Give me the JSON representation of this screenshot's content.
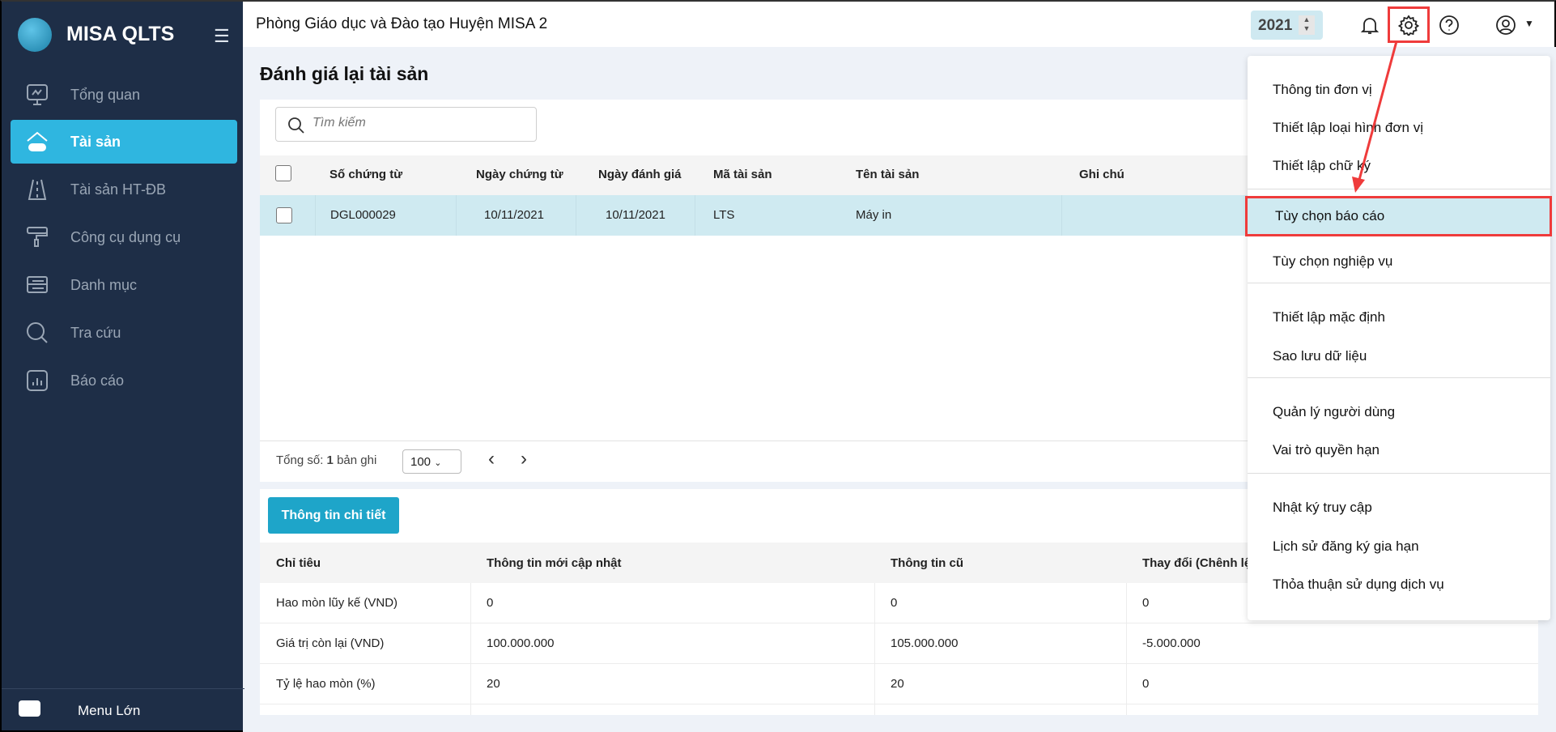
{
  "app": {
    "brand": "MISA QLTS",
    "org": "Phòng Giáo dục và Đào tạo Huyện MISA 2",
    "year": "2021"
  },
  "sidebar": {
    "items": [
      {
        "label": "Tổng quan",
        "icon": "monitor-icon"
      },
      {
        "label": "Tài sản",
        "icon": "house-car-icon",
        "active": true
      },
      {
        "label": "Tài sản HT-ĐB",
        "icon": "road-icon"
      },
      {
        "label": "Công cụ dụng cụ",
        "icon": "paint-roller-icon"
      },
      {
        "label": "Danh mục",
        "icon": "list-icon"
      },
      {
        "label": "Tra cứu",
        "icon": "search-icon"
      },
      {
        "label": "Báo cáo",
        "icon": "chart-icon"
      }
    ],
    "menu_toggle": "Menu Lớn"
  },
  "page": {
    "title": "Đánh giá lại tài sản",
    "search_placeholder": "Tìm kiếm"
  },
  "table": {
    "columns": [
      "Số chứng từ",
      "Ngày chứng từ",
      "Ngày đánh giá",
      "Mã tài sản",
      "Tên tài sản",
      "Ghi chú"
    ],
    "rows": [
      [
        "DGL000029",
        "10/11/2021",
        "10/11/2021",
        "LTS",
        "Máy in",
        ""
      ]
    ]
  },
  "footer": {
    "total_label": "Tổng số:",
    "total": "1",
    "total_suffix": "bản ghi",
    "page_size": "100"
  },
  "detail": {
    "button": "Thông tin chi tiết",
    "columns": [
      "Chỉ tiêu",
      "Thông tin mới cập nhật",
      "Thông tin cũ",
      "Thay đổi (Chênh lệ"
    ],
    "rows": [
      [
        "Hao mòn lũy kế (VND)",
        "0",
        "0",
        "0"
      ],
      [
        "Giá trị còn lại (VND)",
        "100.000.000",
        "105.000.000",
        "-5.000.000"
      ],
      [
        "Tỷ lệ hao mòn (%)",
        "20",
        "20",
        "0"
      ]
    ]
  },
  "dropdown": {
    "items": [
      "Thông tin đơn vị",
      "Thiết lập loại hình đơn vị",
      "Thiết lập chữ ký",
      "Tùy chọn báo cáo",
      "Tùy chọn nghiệp vụ",
      "Thiết lập mặc định",
      "Sao lưu dữ liệu",
      "Quản lý người dùng",
      "Vai trò quyền hạn",
      "Nhật ký truy cập",
      "Lịch sử đăng ký gia hạn",
      "Thỏa thuận sử dụng dịch vụ"
    ]
  },
  "colors": {
    "sidebar": "#1e2e47",
    "accent": "#2fb6e0",
    "button": "#1ea5c9",
    "highlight": "#cfeaf1",
    "annotation": "#ef3b3b"
  }
}
